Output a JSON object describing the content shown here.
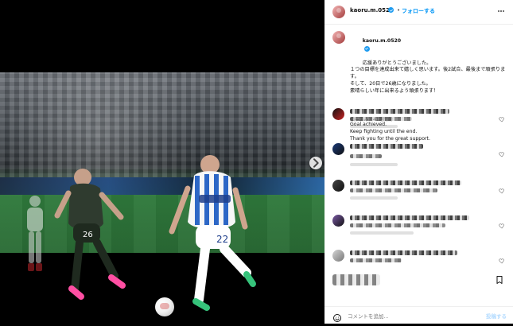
{
  "header": {
    "username": "kaoru.m.0520",
    "separator": "•",
    "follow_label": "フォローする",
    "more_icon": "more-horizontal-icon"
  },
  "caption": {
    "username": "kaoru.m.0520",
    "text_ja": "応援ありがとうございました。\n１つの目標を達成出来て嬉しく思います。後2試合、最後まで頑張ります。\nそして、20日で26歳になりました。\n素晴らしい年に出来るよう頑張ります！",
    "text_en": "Goal achieved.\nKeep fighting until the end.\nThank you for the great support.",
    "edited_label": "編集済み・41週間前"
  },
  "actions": {
    "bookmark_icon": "bookmark-icon"
  },
  "comment_box": {
    "emoji_icon": "emoji-icon",
    "placeholder": "コメントを追加...",
    "post_label": "投稿する"
  },
  "colors": {
    "accent": "#0095f6",
    "verified": "#1d9bf0",
    "muted_text": "#8e8e8e",
    "post_disabled": "#b3dbff"
  }
}
